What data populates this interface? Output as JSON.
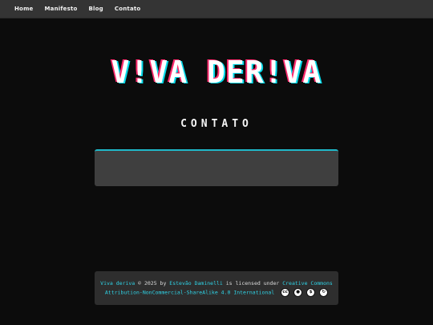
{
  "nav": {
    "items": [
      {
        "label": "Home"
      },
      {
        "label": "Manifesto"
      },
      {
        "label": "Blog"
      },
      {
        "label": "Contato"
      }
    ]
  },
  "header": {
    "site_title": "V!VA DER!VA",
    "page_title": "CONTATO"
  },
  "main": {
    "content_text": ""
  },
  "footer": {
    "work_title": "Viva deriva",
    "cc_text": "© 2025 by",
    "author": "Estevão Daminelli",
    "licensed_text": "is licensed under",
    "license_name": "Creative Commons Attribution-NonCommercial-ShareAlike 4.0 International",
    "license_icons": [
      "cc-icon",
      "by-icon",
      "nc-icon",
      "sa-icon"
    ]
  },
  "colors": {
    "accent": "#2fd3e6",
    "glitch_pink": "#ff2a6d",
    "glitch_cyan": "#05d9e8",
    "background": "#0c0c0c",
    "nav_bg": "#343434"
  }
}
